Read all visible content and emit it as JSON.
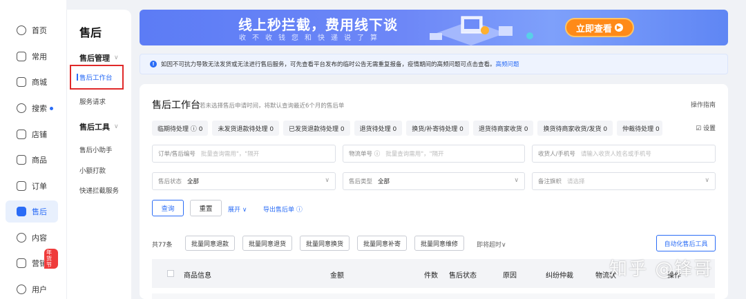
{
  "rail": {
    "items": [
      {
        "label": "首页",
        "icon": "home-icon"
      },
      {
        "label": "常用",
        "icon": "folder-icon"
      },
      {
        "label": "商城",
        "icon": "house-icon"
      },
      {
        "label": "搜索",
        "icon": "search-icon"
      },
      {
        "label": "店铺",
        "icon": "store-icon"
      },
      {
        "label": "商品",
        "icon": "product-icon"
      },
      {
        "label": "订单",
        "icon": "order-icon"
      },
      {
        "label": "售后",
        "icon": "aftersale-icon",
        "active": true
      },
      {
        "label": "内容",
        "icon": "content-icon"
      },
      {
        "label": "营销",
        "icon": "marketing-icon",
        "badge": "年货节"
      },
      {
        "label": "用户",
        "icon": "user-icon"
      }
    ]
  },
  "subnav": {
    "title": "售后",
    "group1": "售后管理",
    "item_workbench": "售后工作台",
    "item_service": "服务请求",
    "group2": "售后工具",
    "item_helper": "售后小助手",
    "item_small_pay": "小额打款",
    "item_intercept": "快递拦截服务"
  },
  "banner": {
    "headline": "线上秒拦截，费用线下谈",
    "subline": "收不收钱您和快递说了算",
    "cta": "立即查看"
  },
  "notice": {
    "text": "如因不可抗力导致无法发货或无法进行售后服务，可先查看平台发布的临时公告无需重复报备，疫情期间的高频问题可点击查看。",
    "link": "高频问题"
  },
  "card": {
    "title": "售后工作台",
    "subtitle": "若未选择售后申请时间，将默认查询最近6个月的售后单",
    "guide": "操作指南",
    "settings": "☑ 设置",
    "statuses": [
      "临期待处理 ⓘ 0",
      "未发货退款待处理 0",
      "已发货退款待处理 0",
      "退货待处理 0",
      "换货/补寄待处理 0",
      "退货待商家收货 0",
      "换货待商家收货/发货 0",
      "仲裁待处理 0"
    ],
    "filters": {
      "order_label": "订单/售后编号",
      "order_ph": "批量查询需用\"，\"隔开",
      "logistics_label": "物流单号 ⓘ",
      "logistics_ph": "批量查询需用\"，\"隔开",
      "receiver_label": "收货人/手机号",
      "receiver_ph": "请输入收货人姓名或手机号",
      "status_label": "售后状态",
      "status_val": "全部",
      "type_label": "售后类型",
      "type_val": "全部",
      "flag_label": "备注旗帜",
      "flag_ph": "请选择"
    },
    "actions": {
      "query": "查询",
      "reset": "重置",
      "expand": "展开",
      "export": "导出售后单 ⓘ"
    },
    "batch": {
      "total": "共77条",
      "b1": "批量同意退款",
      "b2": "批量同意退货",
      "b3": "批量同意换货",
      "b4": "批量同意补寄",
      "b5": "批量同意维修",
      "soon": "即将超时",
      "auto": "自动化售后工具"
    },
    "columns": [
      "商品信息",
      "金额",
      "件数",
      "售后状态",
      "原因",
      "纠纷仲裁",
      "物流状",
      "操作"
    ]
  },
  "watermark": "知乎 @锋哥"
}
